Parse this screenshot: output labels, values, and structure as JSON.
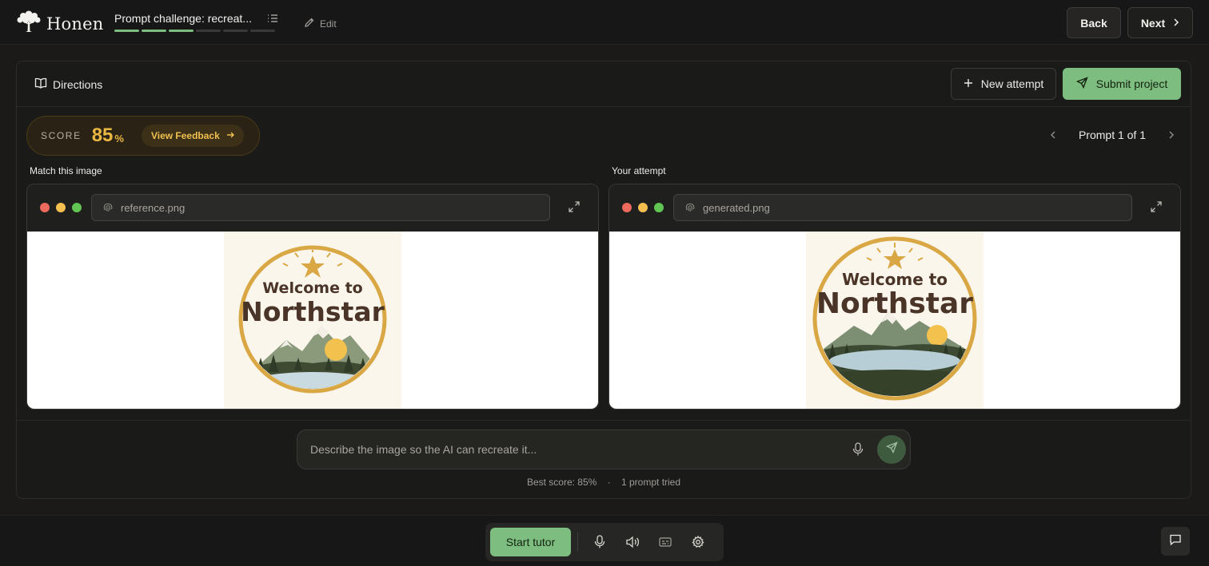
{
  "app": {
    "name": "Honen"
  },
  "header": {
    "challenge_title": "Prompt challenge: recreat...",
    "progress": {
      "completed_steps": 3,
      "total_steps": 6
    },
    "edit_label": "Edit",
    "back_label": "Back",
    "next_label": "Next"
  },
  "toolbar": {
    "directions_label": "Directions",
    "new_attempt_label": "New attempt",
    "submit_label": "Submit project"
  },
  "score": {
    "label": "SCORE",
    "value": "85",
    "unit": "%",
    "feedback_label": "View Feedback"
  },
  "prompt_nav": {
    "label": "Prompt 1 of 1"
  },
  "reference": {
    "caption": "Match this image",
    "filename": "reference.png",
    "badge": {
      "line1": "Welcome to",
      "line2": "Northstar"
    }
  },
  "attempt": {
    "caption": "Your attempt",
    "filename": "generated.png",
    "badge": {
      "line1": "Welcome to",
      "line2": "Northstar"
    }
  },
  "composer": {
    "placeholder": "Describe the image so the AI can recreate it..."
  },
  "stats": {
    "best_score": "Best score: 85%",
    "separator": "·",
    "prompts_tried": "1 prompt tried"
  },
  "bottom": {
    "tutor_label": "Start tutor"
  },
  "colors": {
    "accent_green": "#7ebd80",
    "score_gold": "#e9b742",
    "badge_ring": "#d9a744",
    "badge_text": "#4a3428"
  }
}
